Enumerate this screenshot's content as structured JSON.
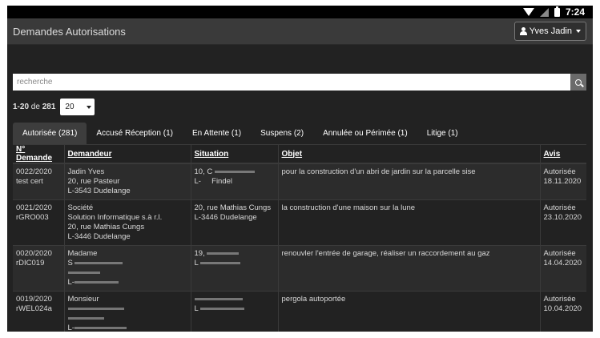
{
  "status_bar": {
    "time": "7:24"
  },
  "app": {
    "title": "Demandes Autorisations",
    "user": "Yves Jadin"
  },
  "search": {
    "placeholder": "recherche",
    "value": ""
  },
  "pagination": {
    "range": "1-20",
    "of_label": "de",
    "total": "281",
    "page_size": "20"
  },
  "tabs": [
    {
      "label": "Autorisée (281)",
      "active": true
    },
    {
      "label": "Accusé Réception (1)",
      "active": false
    },
    {
      "label": "En Attente (1)",
      "active": false
    },
    {
      "label": "Suspens (2)",
      "active": false
    },
    {
      "label": "Annulée ou Périmée (1)",
      "active": false
    },
    {
      "label": "Litige (1)",
      "active": false
    }
  ],
  "table": {
    "headers": [
      "N° Demande",
      "Demandeur",
      "Situation",
      "Objet",
      "Avis"
    ],
    "rows": [
      {
        "numero": [
          "0022/2020",
          "test cert"
        ],
        "demandeur": [
          "Jadin Yves",
          "20, rue Pasteur",
          "L-3543 Dudelange"
        ],
        "situation": [
          "10, C",
          "L-     Findel"
        ],
        "objet": "pour la construction d'un abri de jardin sur la parcelle sise",
        "avis": [
          "Autorisée",
          "18.11.2020"
        ]
      },
      {
        "numero": [
          "0021/2020",
          "rGRO003"
        ],
        "demandeur": [
          "Société",
          "Solution Informatique s.à r.l.",
          "20, rue Mathias Cungs",
          "L-3446 Dudelange"
        ],
        "situation": [
          "20, rue Mathias Cungs",
          "L-3446 Dudelange"
        ],
        "objet": "la construction d'une maison sur la lune",
        "avis": [
          "Autorisée",
          "23.10.2020"
        ]
      },
      {
        "numero": [
          "0020/2020",
          "rDIC019"
        ],
        "demandeur": [
          "Madame",
          "S",
          "",
          "L-"
        ],
        "situation": [
          "19,",
          "L"
        ],
        "objet": "renouvler l'entrée de garage, réaliser un raccordement au gaz",
        "avis": [
          "Autorisée",
          "14.04.2020"
        ]
      },
      {
        "numero": [
          "0019/2020",
          "rWEL024a"
        ],
        "demandeur": [
          "Monsieur",
          "",
          "",
          "L-"
        ],
        "situation": [
          "",
          "L"
        ],
        "objet": "pergola autoportée",
        "avis": [
          "Autorisée",
          "10.04.2020"
        ]
      }
    ]
  },
  "colors": {
    "background": "#222222",
    "navbar": "#3a3a3a",
    "active_tab": "#3d3d3d"
  },
  "icons": [
    "wifi-icon",
    "signal-icon",
    "battery-icon",
    "user-icon",
    "caret-down-icon",
    "search-icon"
  ]
}
